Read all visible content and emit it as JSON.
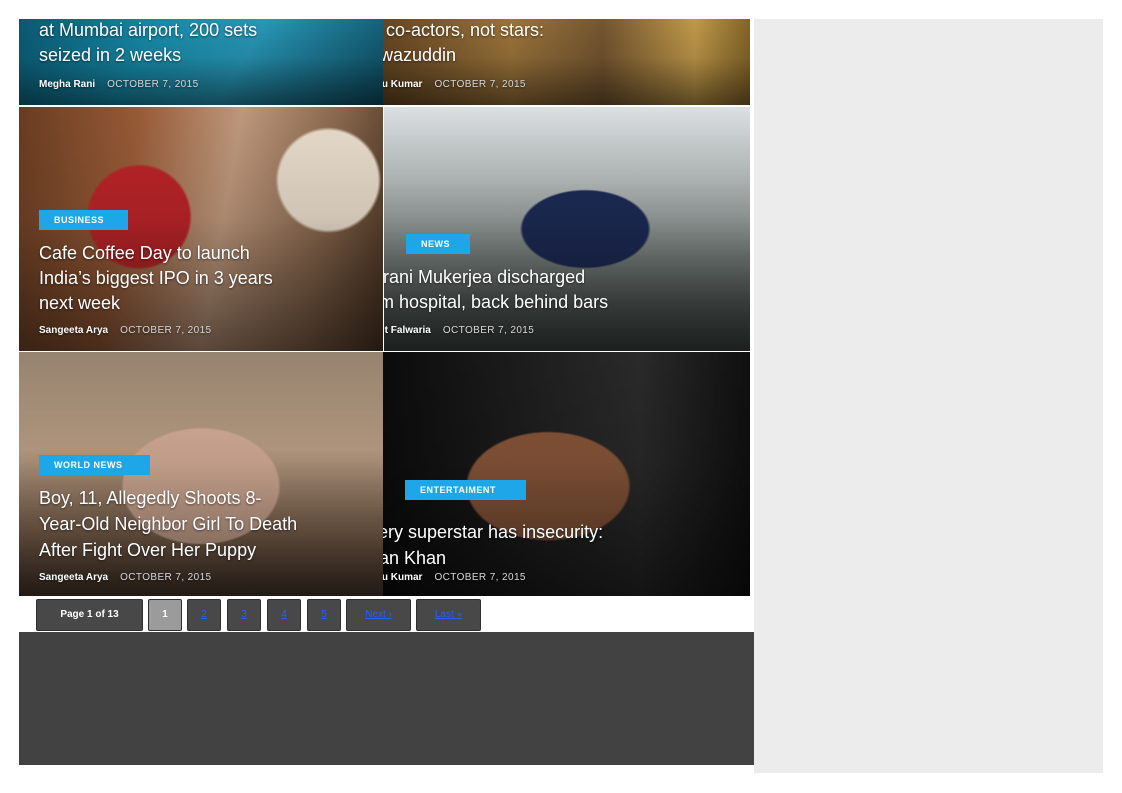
{
  "articles": [
    {
      "category": "",
      "title_line1": "at Mumbai airport, 200 sets",
      "title_line2": "seized in 2 weeks",
      "author": "Megha Rani",
      "date": "OCTOBER 7, 2015"
    },
    {
      "category": "",
      "title_line1": "my co-actors, not stars:",
      "title_line2": " Nawazuddin",
      "author": "Sonu Kumar",
      "date": "OCTOBER 7, 2015"
    },
    {
      "category": "BUSINESS",
      "title_line1": "Cafe Coffee Day to launch",
      "title_line2": "India’s biggest IPO in 3 years",
      "title_line3": "next week",
      "author": "Sangeeta Arya",
      "date": "OCTOBER 7, 2015"
    },
    {
      "category": "NEWS",
      "title_line1": " Indrani Mukerjea discharged",
      "title_line2": "from hospital, back behind bars",
      "author": "Ankit Falwaria",
      "date": "OCTOBER 7, 2015"
    },
    {
      "category": "WORLD NEWS",
      "title_line1": "Boy, 11, Allegedly Shoots 8-",
      "title_line2": "Year-Old Neighbor Girl To Death",
      "title_line3": "After Fight Over Her Puppy",
      "author": "Sangeeta Arya",
      "date": "OCTOBER 7, 2015"
    },
    {
      "category": "ENTERTAIMENT",
      "title_line1": " Every superstar has insecurity:",
      "title_line2": " Irrfan Khan",
      "author": "Sonu Kumar",
      "date": "OCTOBER 7, 2015"
    }
  ],
  "pagination": {
    "info": "Page 1 of 13",
    "current": "1",
    "pages": [
      "2",
      "3",
      "4",
      "5"
    ],
    "next": "Next ›",
    "last": "Last »"
  }
}
